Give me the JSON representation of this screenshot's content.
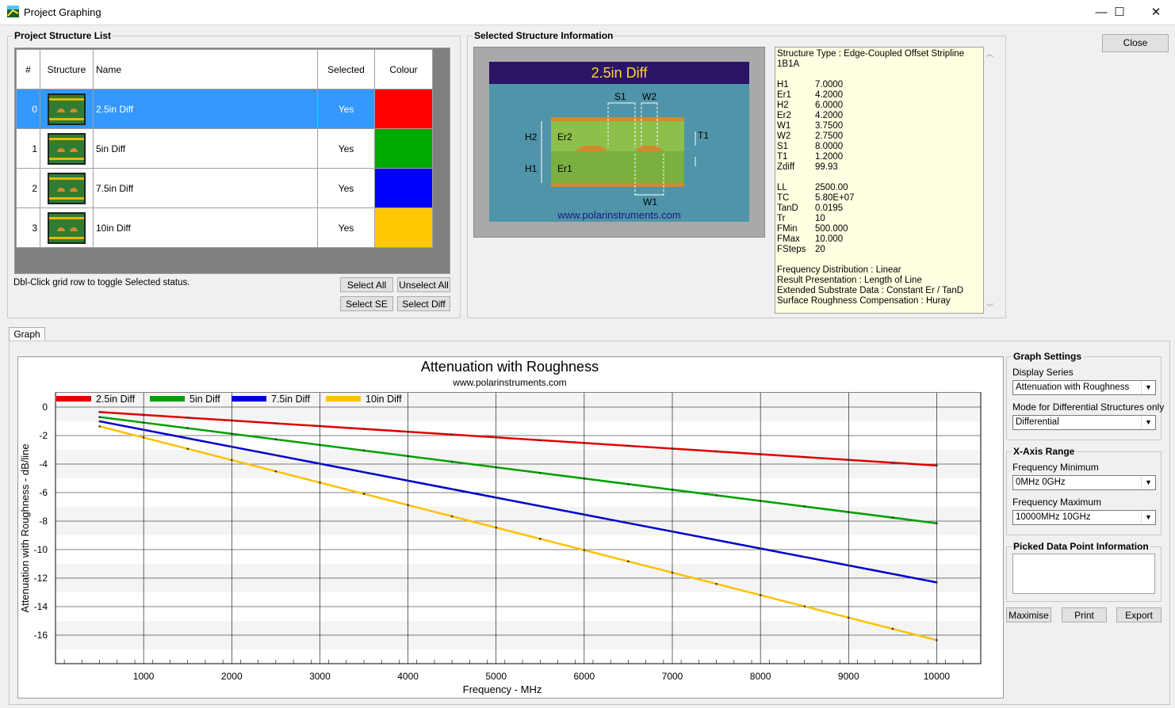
{
  "window": {
    "title": "Project Graphing",
    "minimize": "—",
    "maximize": "☐",
    "close": "✕"
  },
  "structure_list": {
    "label": "Project Structure List",
    "columns": [
      "#",
      "Structure",
      "Name",
      "Selected",
      "Colour"
    ],
    "rows": [
      {
        "index": "0",
        "name": "2.5in Diff",
        "selected": "Yes",
        "colour": "#ff0000"
      },
      {
        "index": "1",
        "name": "5in Diff",
        "selected": "Yes",
        "colour": "#00aa00"
      },
      {
        "index": "2",
        "name": "7.5in Diff",
        "selected": "Yes",
        "colour": "#0000ff"
      },
      {
        "index": "3",
        "name": "10in Diff",
        "selected": "Yes",
        "colour": "#ffc800"
      }
    ],
    "hint": "Dbl-Click grid row to toggle Selected status.",
    "buttons": {
      "select_all": "Select All",
      "unselect_all": "Unselect All",
      "select_se": "Select SE",
      "select_diff": "Select Diff"
    }
  },
  "structure_info": {
    "label": "Selected Structure Information",
    "diagram": {
      "title": "2.5in Diff",
      "url": "www.polarinstruments.com",
      "labels": {
        "s1": "S1",
        "w2": "W2",
        "h2": "H2",
        "er2": "Er2",
        "t1": "T1",
        "h1": "H1",
        "er1": "Er1",
        "w1": "W1"
      }
    },
    "type_line": "Structure Type :  Edge-Coupled Offset Stripline 1B1A",
    "params": [
      {
        "k": "H1",
        "v": "7.0000"
      },
      {
        "k": "Er1",
        "v": "4.2000"
      },
      {
        "k": "H2",
        "v": "6.0000"
      },
      {
        "k": "Er2",
        "v": "4.2000"
      },
      {
        "k": "W1",
        "v": "3.7500"
      },
      {
        "k": "W2",
        "v": "2.7500"
      },
      {
        "k": "S1",
        "v": "8.0000"
      },
      {
        "k": "T1",
        "v": "1.2000"
      },
      {
        "k": "Zdiff",
        "v": "99.93"
      }
    ],
    "params2": [
      {
        "k": "LL",
        "v": "2500.00"
      },
      {
        "k": "TC",
        "v": "5.80E+07"
      },
      {
        "k": "TanD",
        "v": "0.0195"
      },
      {
        "k": "Tr",
        "v": "10"
      },
      {
        "k": "FMin",
        "v": "500.000"
      },
      {
        "k": "FMax",
        "v": "10.000"
      },
      {
        "k": "FSteps",
        "v": "20"
      }
    ],
    "notes": [
      "Frequency Distribution :  Linear",
      "Result Presentation :  Length of Line",
      "Extended Substrate Data :  Constant Er / TanD",
      "Surface Roughness Compensation :  Huray"
    ]
  },
  "close_button": "Close",
  "tab_graph": "Graph",
  "graph_settings": {
    "label": "Graph Settings",
    "display_series_label": "Display Series",
    "display_series_value": "Attenuation with Roughness",
    "mode_label": "Mode for Differential Structures only",
    "mode_value": "Differential",
    "xaxis_label": "X-Axis Range",
    "fmin_label": "Frequency Minimum",
    "fmin_value": "0MHz  0GHz",
    "fmax_label": "Frequency Maximum",
    "fmax_value": "10000MHz  10GHz",
    "picked_label": "Picked Data Point Information",
    "buttons": {
      "maximise": "Maximise",
      "print": "Print",
      "export": "Export"
    }
  },
  "chart_data": {
    "type": "line",
    "title": "Attenuation with Roughness",
    "subtitle": "www.polarinstruments.com",
    "xlabel": "Frequency - MHz",
    "ylabel": "Attenuation with Roughness - dB/line",
    "xlim": [
      0,
      10500
    ],
    "ylim": [
      -18,
      1
    ],
    "xticks": [
      1000,
      2000,
      3000,
      4000,
      5000,
      6000,
      7000,
      8000,
      9000,
      10000
    ],
    "yticks": [
      0,
      -2,
      -4,
      -6,
      -8,
      -10,
      -12,
      -14,
      -16
    ],
    "grid": true,
    "legend_position": "top-left",
    "series": [
      {
        "name": "2.5in Diff",
        "color": "#e00000",
        "points": [
          [
            500,
            -0.35
          ],
          [
            10000,
            -4.1
          ]
        ]
      },
      {
        "name": "5in Diff",
        "color": "#00a000",
        "points": [
          [
            500,
            -0.7
          ],
          [
            10000,
            -8.15
          ]
        ]
      },
      {
        "name": "7.5in Diff",
        "color": "#0000d0",
        "points": [
          [
            500,
            -1.0
          ],
          [
            10000,
            -12.3
          ]
        ]
      },
      {
        "name": "10in Diff",
        "color": "#ffc000",
        "points": [
          [
            500,
            -1.35
          ],
          [
            10000,
            -16.35
          ]
        ]
      }
    ]
  }
}
